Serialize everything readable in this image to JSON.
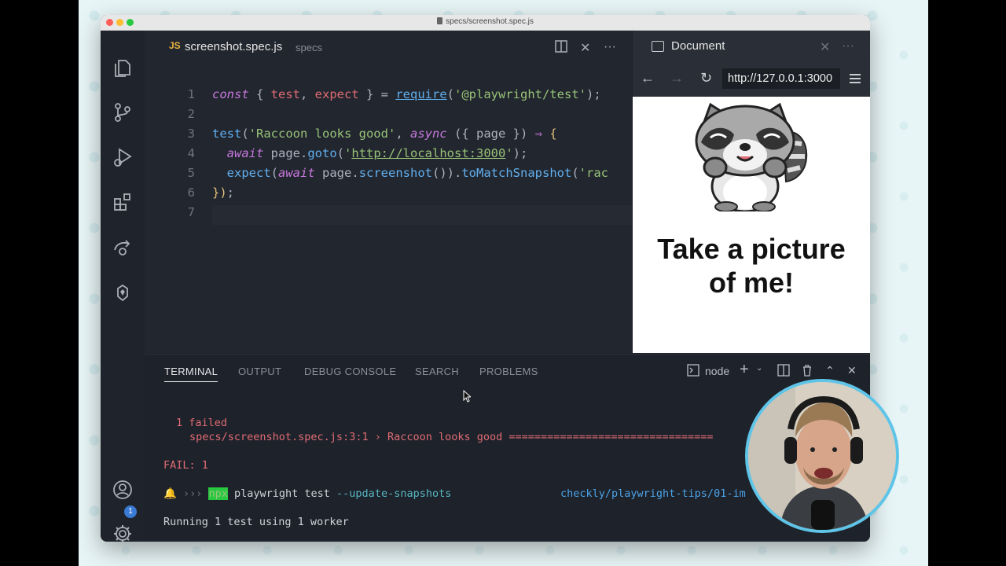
{
  "window": {
    "title": "specs/screenshot.spec.js"
  },
  "activity_bar": {
    "items": [
      {
        "icon": "files-icon"
      },
      {
        "icon": "source-control-icon"
      },
      {
        "icon": "run-debug-icon"
      },
      {
        "icon": "extensions-icon"
      },
      {
        "icon": "remote-icon"
      },
      {
        "icon": "playwright-icon"
      }
    ],
    "account_badge": "1",
    "bottom": [
      {
        "icon": "account-icon"
      },
      {
        "icon": "settings-gear-icon"
      }
    ]
  },
  "editor": {
    "tab": {
      "lang_badge": "JS",
      "filename": "screenshot.spec.js",
      "folder": "specs"
    },
    "line_numbers": [
      "1",
      "2",
      "3",
      "4",
      "5",
      "6",
      "7"
    ],
    "lines": [
      [
        {
          "t": "const",
          "c": "k-purple"
        },
        {
          "t": " { ",
          "c": "k-gray"
        },
        {
          "t": "test",
          "c": "k-red"
        },
        {
          "t": ", ",
          "c": "k-gray"
        },
        {
          "t": "expect",
          "c": "k-red"
        },
        {
          "t": " } = ",
          "c": "k-gray"
        },
        {
          "t": "require",
          "c": "k-blue u"
        },
        {
          "t": "(",
          "c": "k-gray"
        },
        {
          "t": "'@playwright/test'",
          "c": "k-green"
        },
        {
          "t": ");",
          "c": "k-gray"
        }
      ],
      [],
      [
        {
          "t": "test",
          "c": "k-blue"
        },
        {
          "t": "(",
          "c": "k-gray"
        },
        {
          "t": "'Raccoon looks good'",
          "c": "k-green"
        },
        {
          "t": ", ",
          "c": "k-gray"
        },
        {
          "t": "async",
          "c": "k-purple"
        },
        {
          "t": " ({ ",
          "c": "k-gray"
        },
        {
          "t": "page",
          "c": "k-gray"
        },
        {
          "t": " }) ",
          "c": "k-gray"
        },
        {
          "t": "⇒",
          "c": "k-purple"
        },
        {
          "t": " {",
          "c": "k-yellow"
        }
      ],
      [
        {
          "t": "  ",
          "c": "k-gray"
        },
        {
          "t": "await",
          "c": "k-purple"
        },
        {
          "t": " page.",
          "c": "k-gray"
        },
        {
          "t": "goto",
          "c": "k-blue"
        },
        {
          "t": "(",
          "c": "k-gray"
        },
        {
          "t": "'",
          "c": "k-green"
        },
        {
          "t": "http://localhost:3000",
          "c": "k-green u"
        },
        {
          "t": "'",
          "c": "k-green"
        },
        {
          "t": ");",
          "c": "k-gray"
        }
      ],
      [
        {
          "t": "  ",
          "c": "k-gray"
        },
        {
          "t": "expect",
          "c": "k-blue"
        },
        {
          "t": "(",
          "c": "k-gray"
        },
        {
          "t": "await",
          "c": "k-purple"
        },
        {
          "t": " page.",
          "c": "k-gray"
        },
        {
          "t": "screenshot",
          "c": "k-blue"
        },
        {
          "t": "()).",
          "c": "k-gray"
        },
        {
          "t": "toMatchSnapshot",
          "c": "k-blue"
        },
        {
          "t": "(",
          "c": "k-gray"
        },
        {
          "t": "'rac",
          "c": "k-green"
        }
      ],
      [
        {
          "t": "})",
          "c": "k-yellow"
        },
        {
          "t": ";",
          "c": "k-gray"
        }
      ],
      []
    ]
  },
  "browser": {
    "title": "Document",
    "url": "http://127.0.0.1:3000",
    "page_heading_line1": "Take a picture",
    "page_heading_line2": "of me!"
  },
  "panel": {
    "tabs": [
      "TERMINAL",
      "OUTPUT",
      "DEBUG CONSOLE",
      "SEARCH",
      "PROBLEMS"
    ],
    "active_tab": "TERMINAL",
    "shell": "node",
    "terminal": {
      "failed_summary": "1 failed",
      "failed_test": "specs/screenshot.spec.js:3:1 › Raccoon looks good ================================",
      "fail_count": "FAIL: 1",
      "prompt_symbol": "›››",
      "cmd_npx": "npx",
      "cmd_rest": " playwright test ",
      "cmd_flag": "--update-snapshots",
      "branch": "checkly/playwright-tips/01-im",
      "running": "Running 1 test using 1 worker"
    }
  },
  "colors": {
    "accent": "#5ec4e8",
    "editor_bg": "#22262e",
    "terminal_red": "#e06c75"
  }
}
